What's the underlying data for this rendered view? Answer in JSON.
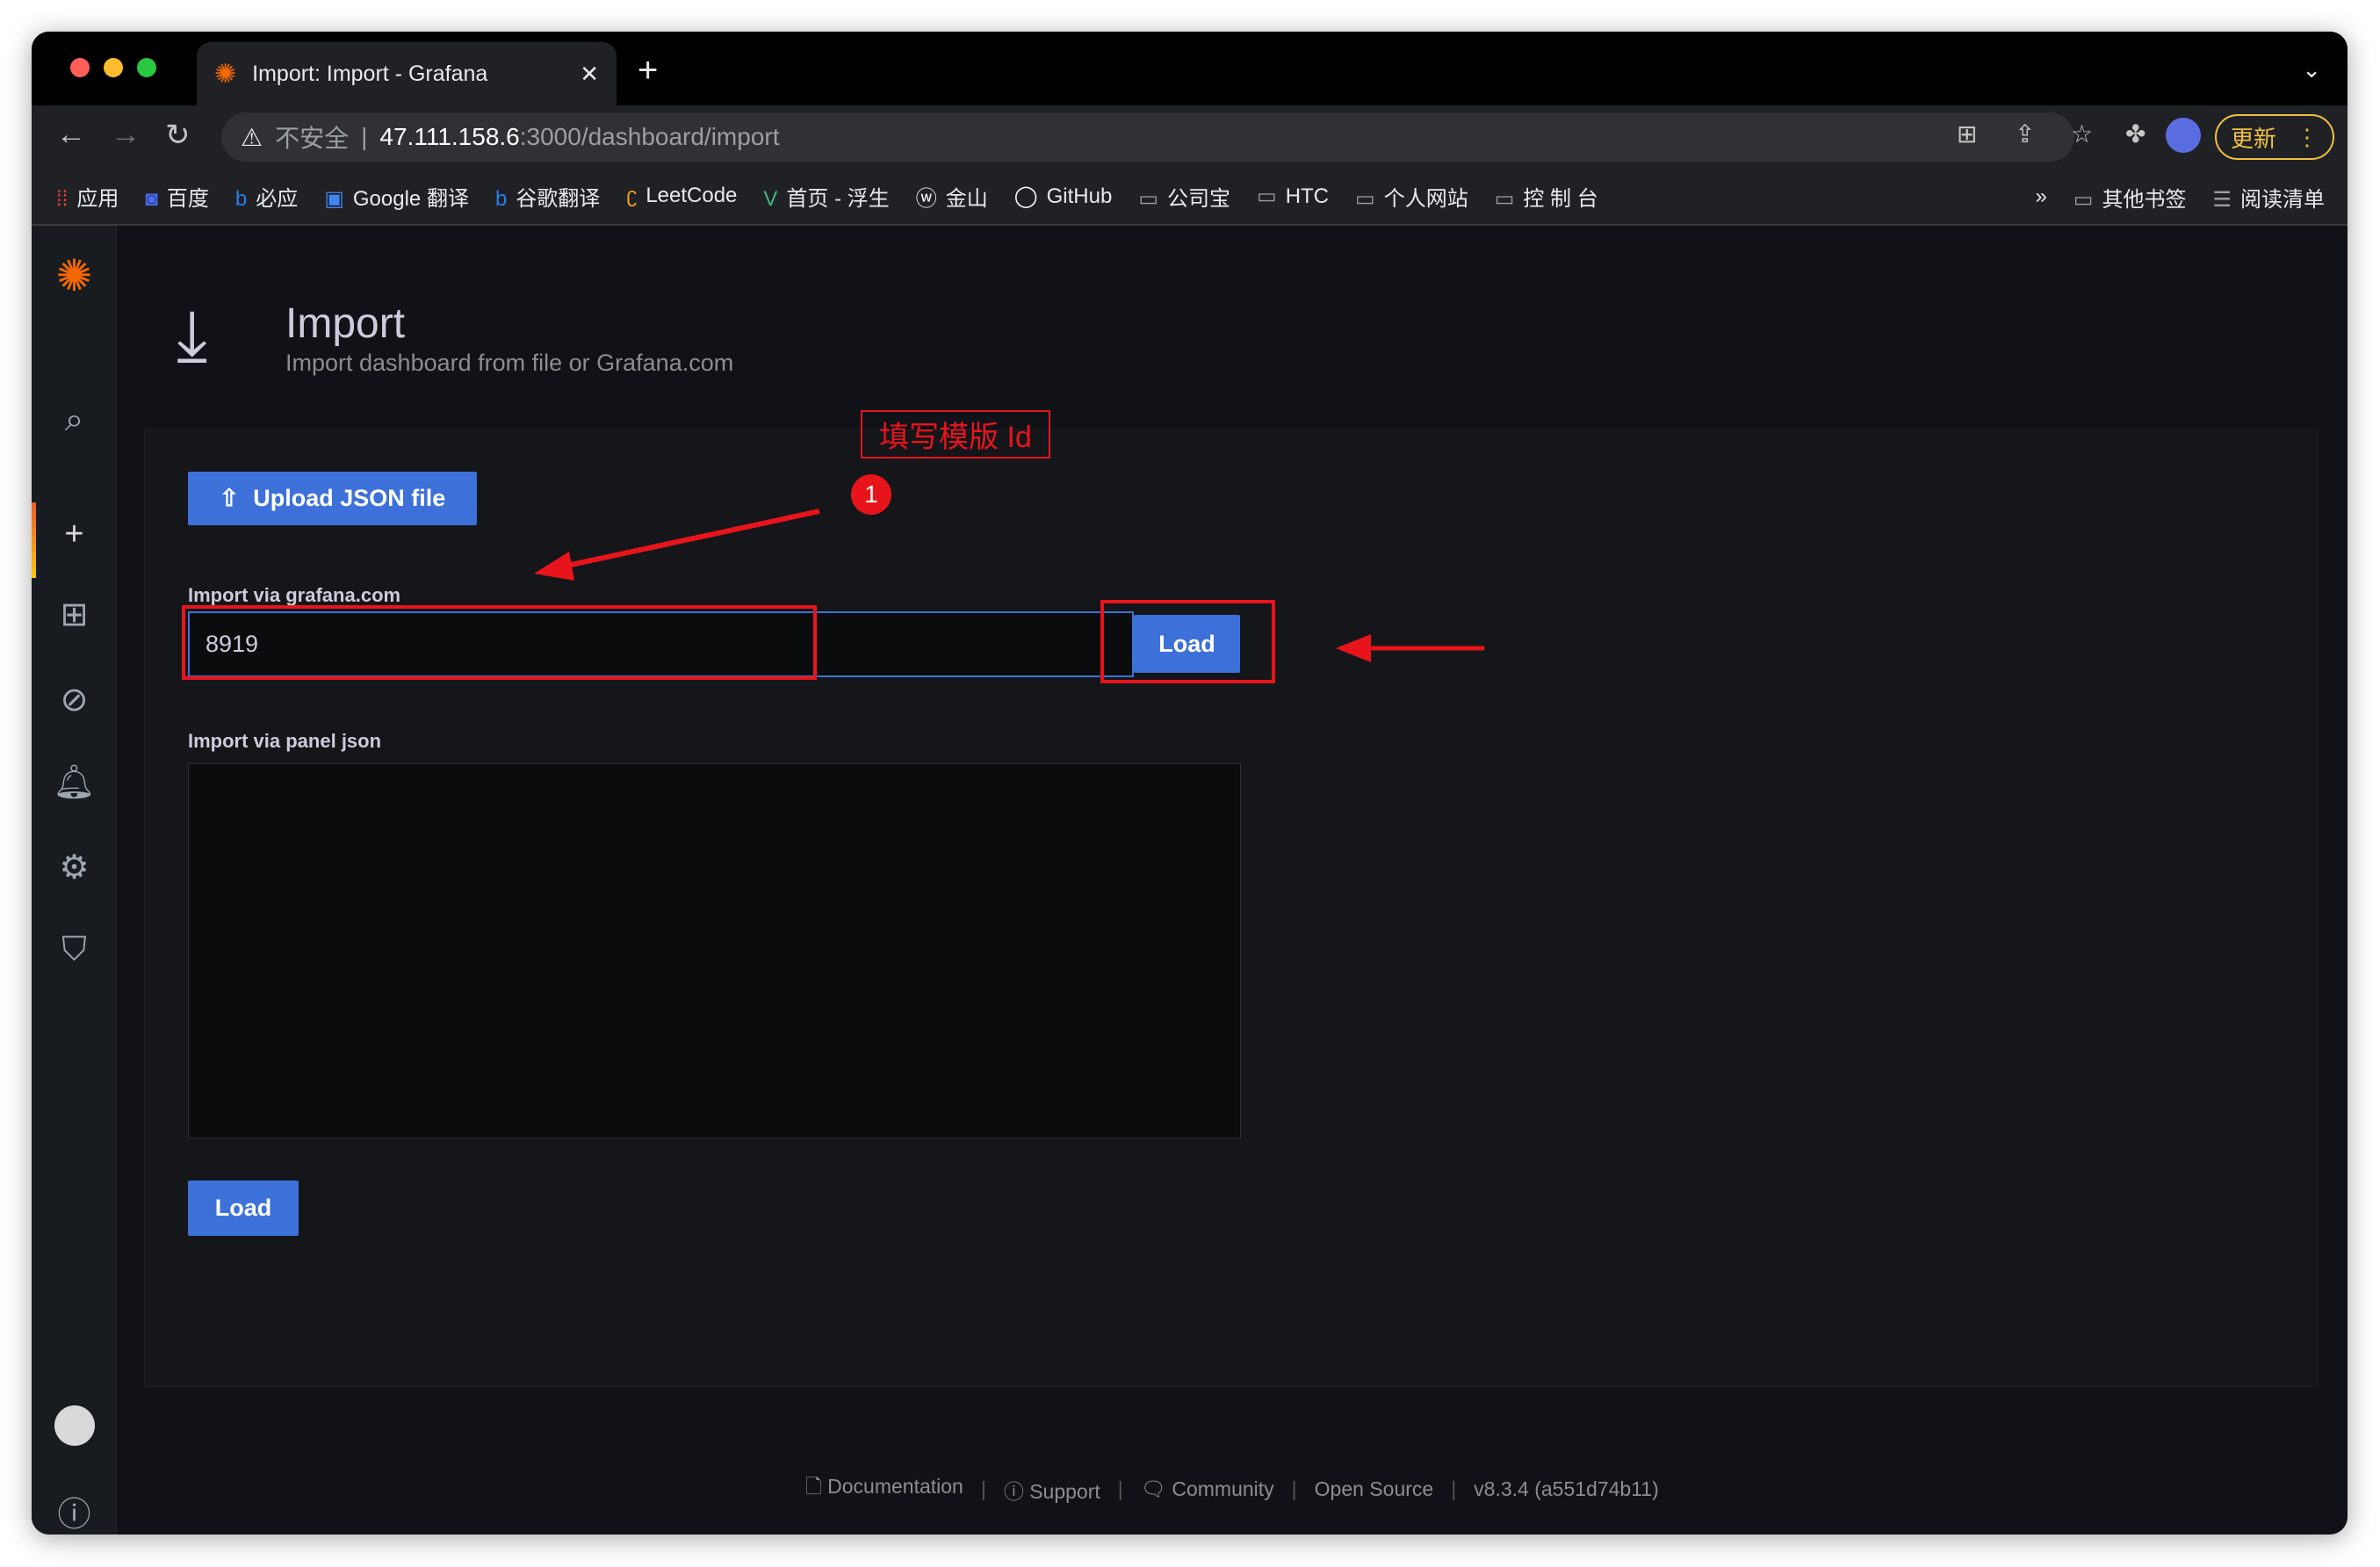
{
  "browser": {
    "tab_title": "Import: Import - Grafana",
    "url_warning": "不安全",
    "url_host": "47.111.158.6",
    "url_path": ":3000/dashboard/import",
    "update_label": "更新",
    "bookmarks": [
      "应用",
      "百度",
      "必应",
      "Google 翻译",
      "谷歌翻译",
      "LeetCode",
      "首页 - 浮生",
      "金山",
      "GitHub",
      "公司宝",
      "HTC",
      "个人网站",
      "控 制 台"
    ],
    "bookmarks_right": [
      "其他书签",
      "阅读清单"
    ]
  },
  "page": {
    "title": "Import",
    "subtitle": "Import dashboard from file or Grafana.com",
    "upload_label": "Upload JSON file",
    "grafana_label": "Import via grafana.com",
    "grafana_value": "8919",
    "load_label": "Load",
    "panel_json_label": "Import via panel json",
    "load_bottom_label": "Load"
  },
  "annotation": {
    "note": "填写模版 Id",
    "badge": "1",
    "color": "#e8141c"
  },
  "footer": {
    "items": [
      "Documentation",
      "Support",
      "Community",
      "Open Source",
      "v8.3.4 (a551d74b11)"
    ]
  },
  "colors": {
    "primary": "#3d71d9",
    "background": "#111217"
  }
}
